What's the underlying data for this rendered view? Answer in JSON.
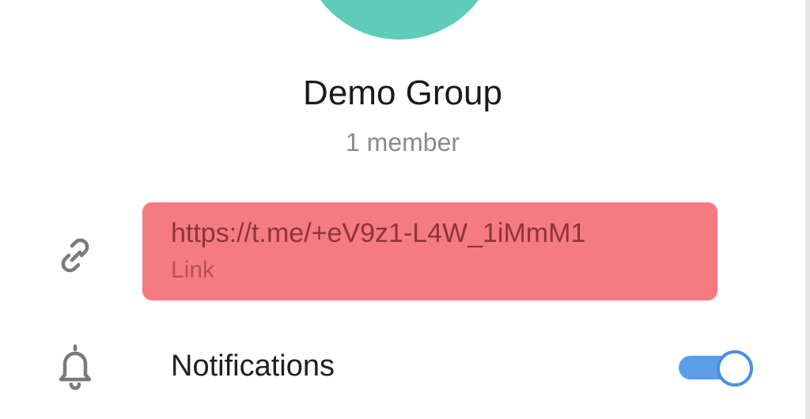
{
  "group": {
    "name": "Demo Group",
    "member_count": "1 member",
    "avatar_color": "#5fcbb9"
  },
  "link_row": {
    "icon": "link-icon",
    "url": "https://t.me/+eV9z1-L4W_1iMmM1",
    "caption": "Link",
    "highlight_color": "#f47b82"
  },
  "notifications_row": {
    "icon": "bell-icon",
    "label": "Notifications",
    "enabled": true,
    "toggle_color": "#5a9ee8"
  }
}
